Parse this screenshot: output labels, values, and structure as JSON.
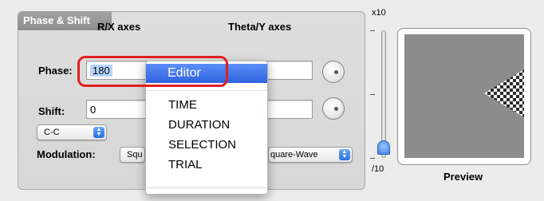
{
  "group": {
    "title": "Phase & Shift"
  },
  "headers": {
    "rx": "R/X axes",
    "ty": "Theta/Y axes"
  },
  "phase": {
    "label": "Phase:",
    "value": "180"
  },
  "shift": {
    "label": "Shift:",
    "value": "0"
  },
  "coupling": {
    "value": "C-C"
  },
  "modulation": {
    "label": "Modulation:",
    "left_value": "Squ",
    "right_value": "quare-Wave"
  },
  "menu": {
    "items": [
      "Editor",
      "TIME",
      "DURATION",
      "SELECTION",
      "TRIAL"
    ],
    "highlighted": "Editor"
  },
  "slider": {
    "top_label": "x10",
    "bottom_label": "/10"
  },
  "preview": {
    "label": "Preview"
  },
  "colors": {
    "highlight": "#2f63e0",
    "annotation_ring": "#e0201e"
  }
}
